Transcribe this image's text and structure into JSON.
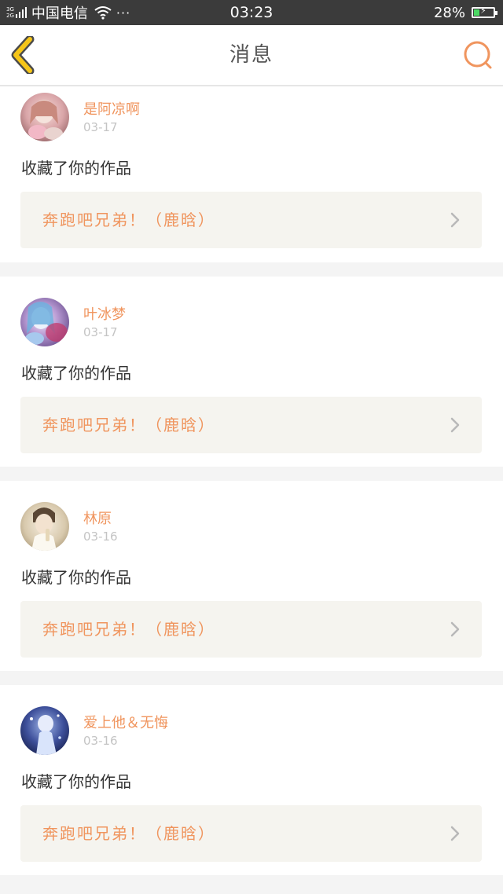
{
  "status_bar": {
    "net_top": "3G",
    "net_bottom": "2G",
    "carrier": "中国电信",
    "more_dots": "···",
    "time": "03:23",
    "battery_percent": "28%",
    "battery_level": 0.28
  },
  "header": {
    "title": "消息"
  },
  "messages": [
    {
      "username": "是阿凉啊",
      "date": "03-17",
      "action": "收藏了你的作品",
      "work_title": "奔跑吧兄弟！（鹿晗）"
    },
    {
      "username": "叶冰梦",
      "date": "03-17",
      "action": "收藏了你的作品",
      "work_title": "奔跑吧兄弟！（鹿晗）"
    },
    {
      "username": "林原",
      "date": "03-16",
      "action": "收藏了你的作品",
      "work_title": "奔跑吧兄弟！（鹿晗）"
    },
    {
      "username": "爱上他＆无悔",
      "date": "03-16",
      "action": "收藏了你的作品",
      "work_title": "奔跑吧兄弟！（鹿晗）"
    }
  ],
  "colors": {
    "accent": "#f0955e",
    "back_arrow": "#f5c518",
    "status_bar": "#3b3b3b",
    "card_link_bg": "#f5f4ef",
    "battery_fill": "#4cd964"
  }
}
